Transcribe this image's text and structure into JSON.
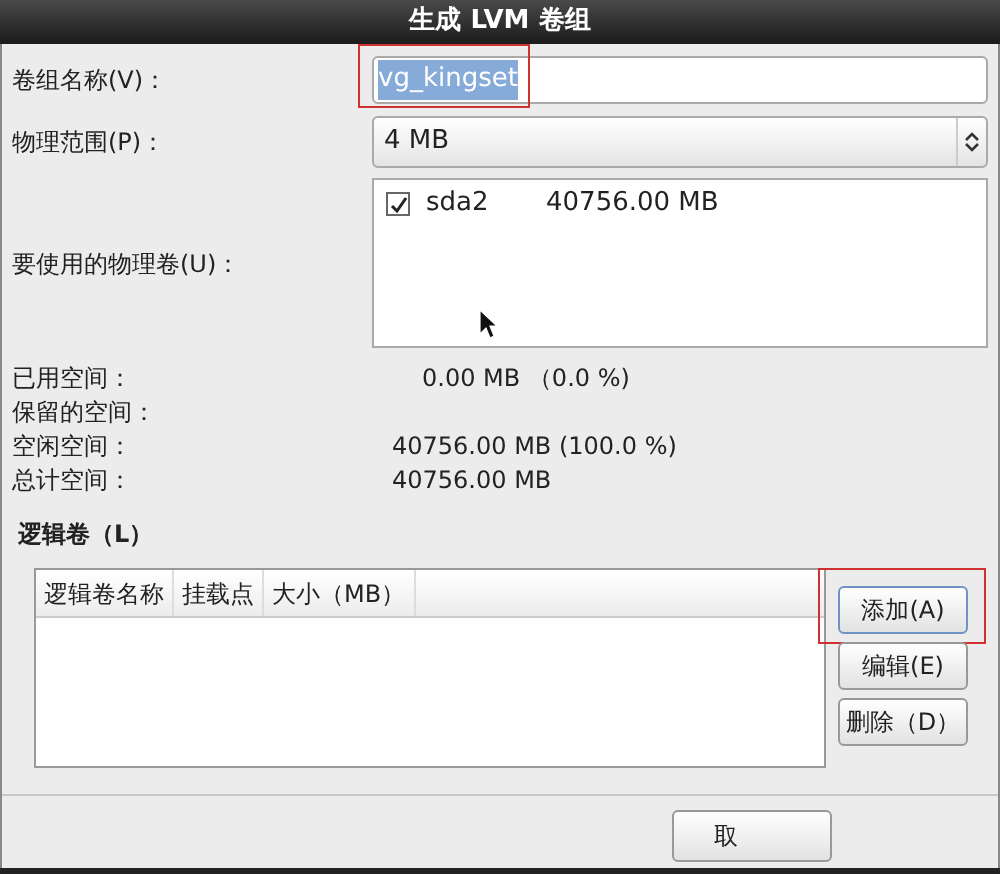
{
  "window": {
    "title": "生成 LVM 卷组"
  },
  "form": [
    {
      "kind": "text",
      "label": "卷组名称(V)：",
      "value": "vg_kingset",
      "text_selected": true,
      "highlighted": true
    },
    {
      "kind": "combo",
      "label": "物理范围(P)：",
      "value": "4 MB"
    },
    {
      "kind": "list",
      "label": "要使用的物理卷(U)：",
      "items": [
        {
          "name": "sda2",
          "size": "40756.00 MB",
          "checked": true
        }
      ]
    }
  ],
  "stats": [
    {
      "label": "已用空间：",
      "value": "0.00 MB （0.0 %)"
    },
    {
      "label": "保留的空间："
    },
    {
      "label": "空闲空间：",
      "value": "40756.00 MB  (100.0 %)"
    },
    {
      "label": "总计空间：",
      "value": "40756.00 MB"
    }
  ],
  "logical_volumes": {
    "title": "逻辑卷（L）",
    "columns": [
      "逻辑卷名称",
      "挂载点",
      "大小（MB）"
    ],
    "buttons": [
      {
        "label": "添加(A)",
        "highlighted": true
      },
      {
        "label": "编辑(E)",
        "highlighted": false
      },
      {
        "label": "删除（D）",
        "highlighted": false
      }
    ]
  },
  "footer_buttons": [
    "取"
  ]
}
